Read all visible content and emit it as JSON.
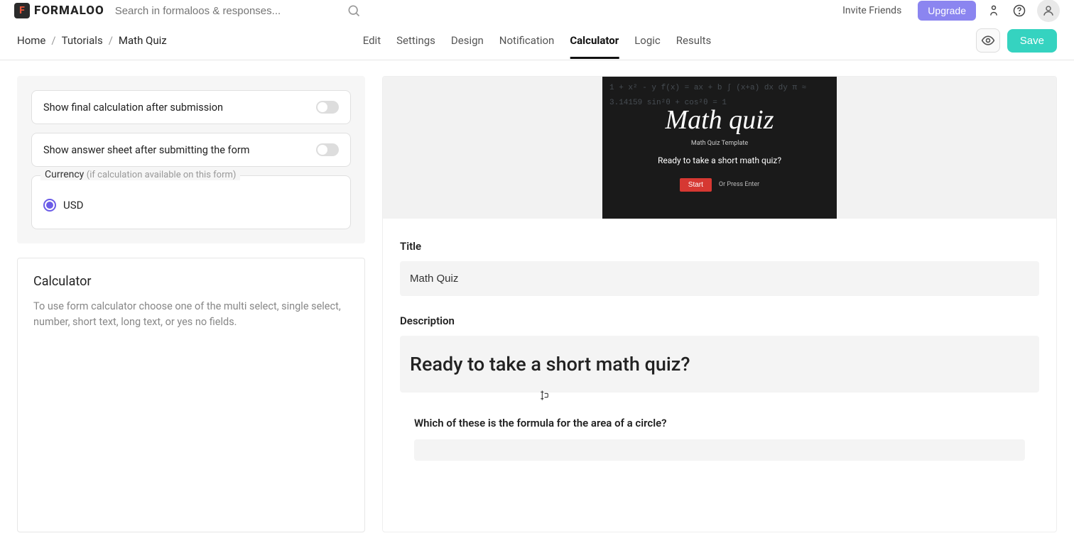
{
  "header": {
    "logo_text": "FORMALOO",
    "search_placeholder": "Search in formaloos & responses...",
    "invite_label": "Invite Friends",
    "upgrade_label": "Upgrade"
  },
  "breadcrumb": {
    "home": "Home",
    "tutorials": "Tutorials",
    "current": "Math Quiz"
  },
  "tabs": [
    "Edit",
    "Settings",
    "Design",
    "Notification",
    "Calculator",
    "Logic",
    "Results"
  ],
  "active_tab": "Calculator",
  "actions": {
    "save": "Save"
  },
  "settings": {
    "show_final": "Show final calculation after submission",
    "show_answer": "Show answer sheet after submitting the form",
    "currency_label": "Currency",
    "currency_hint": "(if calculation available on this form)",
    "currency_value": "USD"
  },
  "calculator_panel": {
    "title": "Calculator",
    "description": "To use form calculator choose one of the multi select, single select, number, short text, long text, or yes no fields."
  },
  "preview": {
    "hero_title": "Math quiz",
    "hero_sub": "Math Quiz Template",
    "hero_question": "Ready to take a short math quiz?",
    "start": "Start",
    "press": "Or Press Enter",
    "chalk": "1 + x² - y   f(x) = ax + b   ∫ (x+a) dx dy   π ≈ 3.14159   sin²θ + cos²θ = 1"
  },
  "form": {
    "title_label": "Title",
    "title_value": "Math Quiz",
    "desc_label": "Description",
    "desc_value": "Ready to take a short math quiz?",
    "question1": "Which of these is the formula for the area of a circle?"
  }
}
